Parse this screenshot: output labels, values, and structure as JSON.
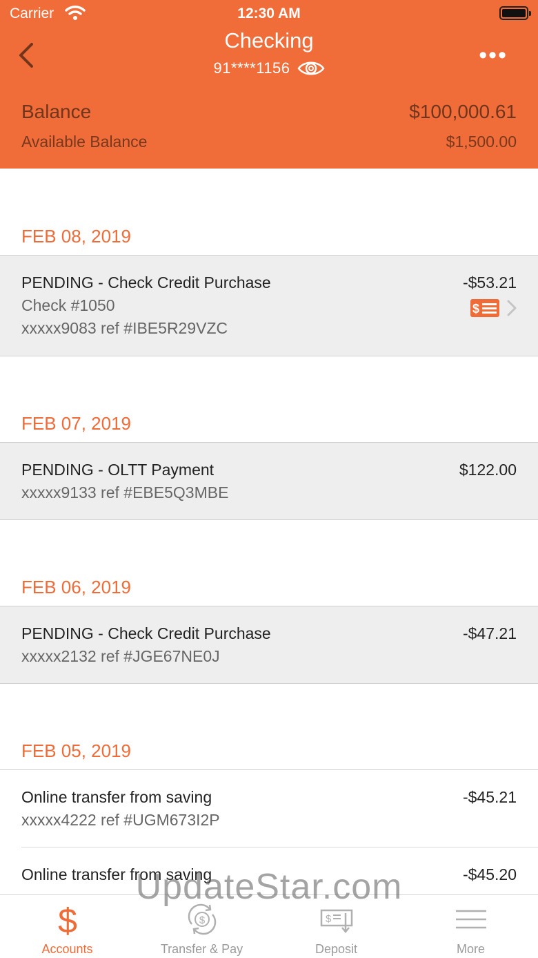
{
  "status_bar": {
    "carrier": "Carrier",
    "time": "12:30 AM"
  },
  "header": {
    "title": "Checking",
    "account_number": "91****1156",
    "balance_label": "Balance",
    "balance_value": "$100,000.61",
    "available_label": "Available Balance",
    "available_value": "$1,500.00"
  },
  "groups": [
    {
      "date": "FEB 08, 2019",
      "transactions": [
        {
          "title": "PENDING - Check Credit Purchase",
          "line2": "Check #1050",
          "line3": "xxxxx9083 ref #IBE5R29VZC",
          "amount": "-$53.21"
        }
      ]
    },
    {
      "date": "FEB 07, 2019",
      "transactions": [
        {
          "title": "PENDING - OLTT Payment",
          "line2": "xxxxx9133 ref #EBE5Q3MBE",
          "amount": "$122.00"
        }
      ]
    },
    {
      "date": "FEB 06, 2019",
      "transactions": [
        {
          "title": "PENDING - Check Credit Purchase",
          "line2": "xxxxx2132 ref #JGE67NE0J",
          "amount": "-$47.21"
        }
      ]
    },
    {
      "date": "FEB 05, 2019",
      "transactions": [
        {
          "title": "Online transfer from saving",
          "line2": "xxxxx4222 ref #UGM673I2P",
          "amount": "-$45.21"
        },
        {
          "title": "Online transfer from saving",
          "amount": "-$45.20"
        }
      ]
    }
  ],
  "tabs": [
    {
      "label": "Accounts",
      "icon": "dollar-icon",
      "active": true
    },
    {
      "label": "Transfer & Pay",
      "icon": "transfer-icon",
      "active": false
    },
    {
      "label": "Deposit",
      "icon": "deposit-check-icon",
      "active": false
    },
    {
      "label": "More",
      "icon": "menu-icon",
      "active": false
    }
  ],
  "watermark": "UpdateStar.com",
  "colors": {
    "accent": "#f06c38",
    "date_text": "#ef6b37",
    "row_bg": "#eeeeee"
  }
}
